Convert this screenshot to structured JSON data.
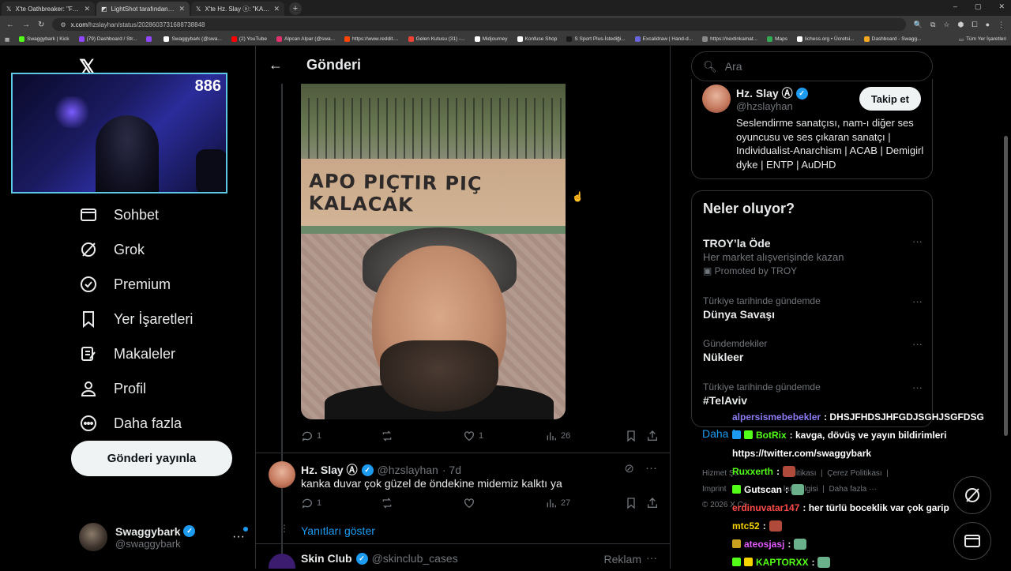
{
  "browser": {
    "tabs": [
      {
        "label": "X'te Oathbreaker: \"FOXVELOX",
        "active": false
      },
      {
        "label": "LightShot tarafından Ekran Gö",
        "active": true
      },
      {
        "label": "X'te Hz. Slay ⓐ: \"KADINLARDA",
        "active": false
      }
    ],
    "new_tab": "+",
    "window_buttons": [
      "–",
      "▢",
      "✕"
    ],
    "url_host": "x.com",
    "url_path": "/hzslayhan/status/2028603731688738848",
    "bookmarks": [
      {
        "label": "Swaggybark | Kick",
        "color": "#53fc18"
      },
      {
        "label": "(79) Dashboard / Str...",
        "color": "#9146ff"
      },
      {
        "label": "",
        "color": "#9146ff"
      },
      {
        "label": "Swaggybark (@swa...",
        "color": "#ffffff"
      },
      {
        "label": "(2) YouTube",
        "color": "#ff0000"
      },
      {
        "label": "Alpcan Alpar (@swa...",
        "color": "#e1306c"
      },
      {
        "label": "https://www.reddit....",
        "color": "#ff4500"
      },
      {
        "label": "Gelen Kutusu (31) -...",
        "color": "#ea4335"
      },
      {
        "label": "Midjourney",
        "color": "#ffffff"
      },
      {
        "label": "Konfuse Shop",
        "color": "#ffffff"
      },
      {
        "label": "S Sport Plus-İstediği...",
        "color": "#1a1a1a"
      },
      {
        "label": "Excalidraw | Hand-d...",
        "color": "#6965db"
      },
      {
        "label": "https://nextinkamat...",
        "color": "#888888"
      },
      {
        "label": "Maps",
        "color": "#34a853"
      },
      {
        "label": "lichess.org • Ücretsi...",
        "color": "#ffffff"
      },
      {
        "label": "Dashboard - Swagg...",
        "color": "#f5a623"
      }
    ],
    "bookmarks_all": "Tüm Yer İşaretleri"
  },
  "stream": {
    "viewer_count": "886"
  },
  "nav": {
    "items": [
      {
        "label": "Sohbet",
        "icon": "envelope-icon"
      },
      {
        "label": "Grok",
        "icon": "grok-icon"
      },
      {
        "label": "Premium",
        "icon": "premium-icon"
      },
      {
        "label": "Yer İşaretleri",
        "icon": "bookmark-icon"
      },
      {
        "label": "Makaleler",
        "icon": "articles-icon"
      },
      {
        "label": "Profil",
        "icon": "person-icon"
      },
      {
        "label": "Daha fazla",
        "icon": "more-circle-icon"
      }
    ],
    "post_button": "Gönderi yayınla"
  },
  "account": {
    "name": "Swaggybark",
    "handle": "@swaggybark"
  },
  "main": {
    "title": "Gönderi",
    "graffiti_text": "APO PIÇTIR PIÇ KALACAK",
    "post_actions": {
      "replies": "1",
      "reposts": "",
      "likes": "1",
      "views": "26"
    },
    "reply": {
      "name": "Hz. Slay Ⓐ",
      "handle": "@hzslayhan",
      "time": "· 7d",
      "text": "kanka duvar çok güzel de öndekine midemiz kalktı ya",
      "actions": {
        "replies": "1",
        "reposts": "",
        "likes": "",
        "views": "27"
      }
    },
    "show_replies": "Yanıtları göster",
    "ad": {
      "name": "Skin Club",
      "handle": "@skinclub_cases",
      "label": "Reklam"
    }
  },
  "sidebar": {
    "search_placeholder": "Ara",
    "profile": {
      "name": "Hz. Slay Ⓐ",
      "handle": "@hzslayhan",
      "follow": "Takip et",
      "bio": "Seslendirme sanatçısı, nam-ı diğer ses oyuncusu ve ses çıkaran sanatçı | Individualist-Anarchism | ACAB | Demigirl dyke | ENTP | AuDHD"
    },
    "trends_title": "Neler oluyor?",
    "trends": [
      {
        "meta": "",
        "name": "TROY’la Öde",
        "sub": "Her market alışverişinde kazan",
        "promo": "Promoted by TROY"
      },
      {
        "meta": "Türkiye tarihinde gündemde",
        "name": "Dünya Savaşı",
        "sub": "",
        "promo": ""
      },
      {
        "meta": "Gündemdekiler",
        "name": "Nükleer",
        "sub": "",
        "promo": ""
      },
      {
        "meta": "Türkiye tarihinde gündemde",
        "name": "#TelAviv",
        "sub": "",
        "promo": ""
      }
    ],
    "show_more": "Daha fa",
    "footer": {
      "line1a": "Hizmet Şa",
      "line1b": "Politikası",
      "line1c": "Çerez Politikası",
      "line2a": "Imprint",
      "line2b": "lam bilgisi",
      "line2c": "Daha fazla ···",
      "line3": "© 2026 X Co"
    }
  },
  "chat": [
    {
      "user": "alpersismebebekler",
      "color": "#8b7cf6",
      "message": ": DHSJFHDSJHFGDJSGHJSGFDSG"
    },
    {
      "user": "BotRix",
      "color": "#53fc18",
      "message": ": kavga, dövüş ve yayın bildirimleri"
    },
    {
      "user": "",
      "color": "#ffffff",
      "message": "https://twitter.com/swaggybark"
    },
    {
      "user": "Ruxxerth",
      "color": "#53fc18",
      "message": ":"
    },
    {
      "user": "Gutscan",
      "color": "#ffffff",
      "message": ":"
    },
    {
      "user": "erdinuvatar147",
      "color": "#ff4a4a",
      "message": ": her türlü boceklik var çok garip"
    },
    {
      "user": "mtc52",
      "color": "#f5d400",
      "message": ":"
    },
    {
      "user": "ateosjasj",
      "color": "#e25cff",
      "message": ":"
    },
    {
      "user": "KAPTORXX",
      "color": "#53fc18",
      "message": ":"
    }
  ]
}
